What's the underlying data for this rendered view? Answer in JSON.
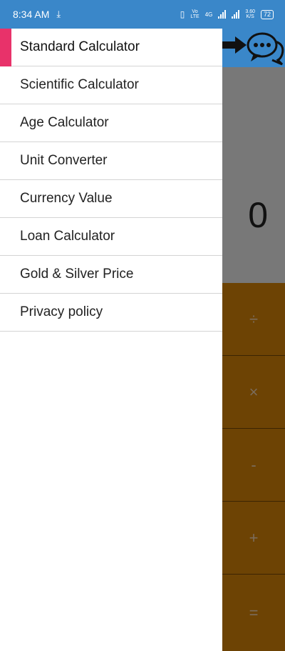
{
  "status_bar": {
    "time": "8:34 AM",
    "lte_top": "Vo",
    "lte_bottom": "LTE",
    "network": "4G",
    "speed_top": "3.60",
    "speed_bottom": "K/S",
    "battery": "72"
  },
  "display": {
    "value": "0"
  },
  "keypad": {
    "keys": [
      "÷",
      "×",
      "-",
      "+",
      "="
    ]
  },
  "drawer": {
    "items": [
      {
        "label": "Standard Calculator",
        "active": true
      },
      {
        "label": "Scientific Calculator"
      },
      {
        "label": "Age Calculator"
      },
      {
        "label": "Unit Converter"
      },
      {
        "label": "Currency Value"
      },
      {
        "label": "Loan Calculator"
      },
      {
        "label": "Gold & Silver Price"
      },
      {
        "label": "Privacy policy"
      }
    ]
  },
  "colors": {
    "toolbar": "#3a87c9",
    "display_bg": "#787878",
    "keypad_bg": "#6d4304",
    "active_indicator": "#e8326a"
  },
  "icons": [
    "download-icon",
    "vibrate-icon",
    "signal-icon",
    "battery-icon",
    "arrow-right-icon",
    "chat-bubble-icon"
  ]
}
